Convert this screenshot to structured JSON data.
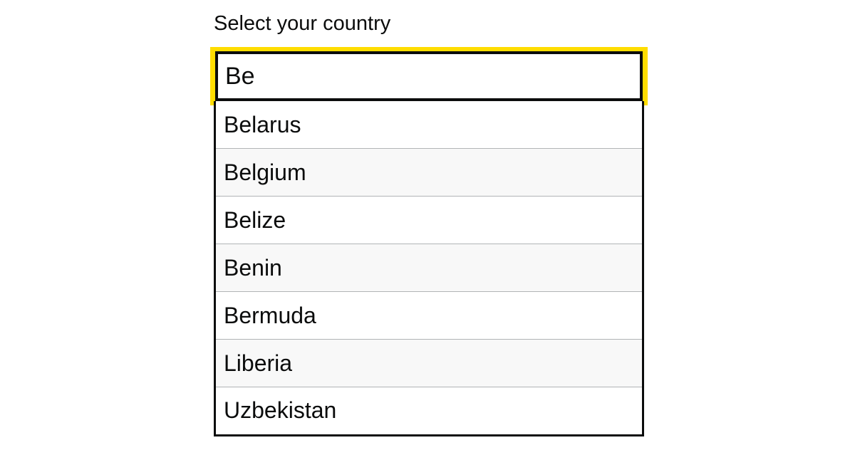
{
  "label": "Select your country",
  "input": {
    "value": "Be"
  },
  "options": [
    "Belarus",
    "Belgium",
    "Belize",
    "Benin",
    "Bermuda",
    "Liberia",
    "Uzbekistan"
  ],
  "colors": {
    "focus": "#ffdd00",
    "border": "#0b0c0c",
    "divider": "#b1b4b6",
    "stripe": "#f8f8f8"
  }
}
